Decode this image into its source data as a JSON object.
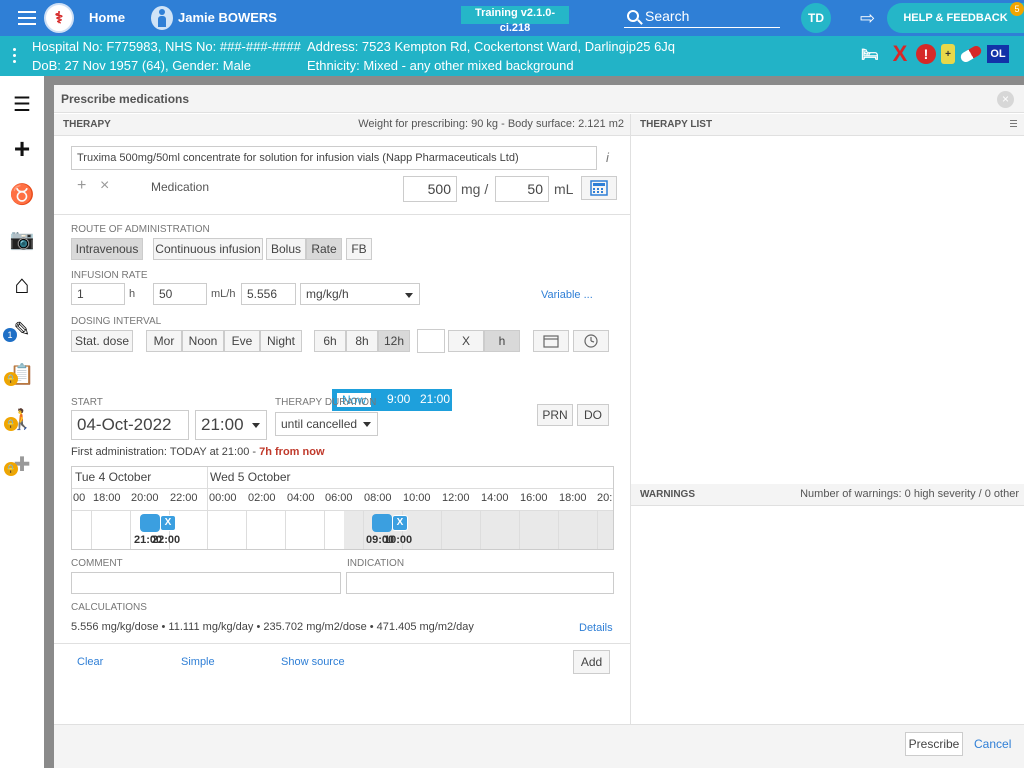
{
  "topbar": {
    "home_label": "Home",
    "logo_glyph": "⚕",
    "patient_name": "Jamie BOWERS",
    "training_label": "Training v2.1.0-ci.218",
    "search_label": "Search",
    "avatar_initials": "TD",
    "logout_glyph": "⇨",
    "help_label": "HELP & FEEDBACK",
    "notification_count": "5"
  },
  "banner": {
    "line1": "Hospital No: F775983, NHS No: ###-###-####",
    "line2": "DoB: 27 Nov 1957 (64), Gender: Male",
    "line3": "Address: 7523 Kempton Rd, Cockertonst Ward, Darlingip25 6Jq",
    "line4": "Ethnicity: Mixed - any other mixed background",
    "icon_bed": "🛏",
    "icon_x": "X",
    "icon_alert": "!",
    "icon_bottle": "+",
    "icon_ol": "OL"
  },
  "rail": {
    "list_glyph": "☰",
    "plus_glyph": "+",
    "stethoscope_glyph": "♉",
    "camera_glyph": "📷",
    "home_glyph": "⌂",
    "edit_glyph": "✎",
    "edit_badge": "1",
    "clipboard_glyph": "📋",
    "walk_glyph": "🚶",
    "cross_glyph": "✚",
    "lock_glyph": "🔒"
  },
  "modal": {
    "title": "Prescribe medications",
    "close_glyph": "×"
  },
  "therapy": {
    "header": "THERAPY",
    "weight_info": "Weight for prescribing: 90 kg - Body surface: 2.121 m2",
    "medication_name": "Truxima 500mg/50ml concentrate for solution for infusion vials (Napp Pharmaceuticals Ltd)",
    "info_glyph": "i",
    "plus_glyph": "+",
    "x_glyph": "×",
    "medication_label": "Medication",
    "dose_mg": "500",
    "mg_unit": "mg /",
    "dose_ml": "50",
    "ml_unit": "mL",
    "route_label": "ROUTE OF ADMINISTRATION",
    "route_intravenous": "Intravenous",
    "route_continuous": "Continuous infusion",
    "route_bolus": "Bolus",
    "route_rate": "Rate",
    "route_fb": "FB",
    "infusion_label": "INFUSION RATE",
    "infusion_hours": "1",
    "h_unit": "h",
    "infusion_ml": "50",
    "mlh_unit": "mL/h",
    "infusion_rate": "5.556",
    "infusion_unit_select": "mg/kg/h",
    "variable_link": "Variable ...",
    "dosing_label": "DOSING INTERVAL",
    "stat_dose": "Stat. dose",
    "mor": "Mor",
    "noon": "Noon",
    "eve": "Eve",
    "night": "Night",
    "h6": "6h",
    "h8": "8h",
    "h12": "12h",
    "x_btn": "X",
    "h_btn": "h",
    "chip_now": "Now",
    "chip_900": "9:00",
    "chip_2100": "21:00",
    "start_label": "START",
    "start_date": "04-Oct-2022",
    "start_time": "21:00",
    "duration_label": "THERAPY DURATION",
    "duration_value": "until cancelled",
    "prn": "PRN",
    "do": "DO",
    "first_admin": "First administration: TODAY at 21:00 - ",
    "first_admin_highlight": "7h from now",
    "comment_label": "COMMENT",
    "indication_label": "INDICATION",
    "calculations_label": "CALCULATIONS",
    "calculations_value": "5.556 mg/kg/dose • 11.111 mg/kg/day • 235.702 mg/m2/dose • 471.405 mg/m2/day",
    "details_link": "Details",
    "clear_link": "Clear",
    "simple_link": "Simple",
    "show_source_link": "Show source",
    "add_button": "Add"
  },
  "timeline": {
    "day1": "Tue 4 October",
    "day2": "Wed 5 October",
    "hours": [
      "00",
      "18:00",
      "20:00",
      "22:00",
      "00:00",
      "02:00",
      "04:00",
      "06:00",
      "08:00",
      "10:00",
      "12:00",
      "14:00",
      "16:00",
      "18:00",
      "20:"
    ],
    "dose1_time_a": "21:00",
    "dose1_time_b": "22:00",
    "dose2_time_a": "09:00",
    "dose2_time_b": "10:00",
    "dose_x": "X"
  },
  "therapy_list": {
    "header": "THERAPY LIST"
  },
  "warnings": {
    "header": "WARNINGS",
    "summary": "Number of warnings: 0 high severity / 0 other"
  },
  "footer": {
    "prescribe": "Prescribe",
    "cancel": "Cancel"
  },
  "colors": {
    "topbar": "#2f7fd6",
    "banner": "#22b3c7",
    "accent": "#1ea0dc",
    "alert": "#d62828"
  }
}
